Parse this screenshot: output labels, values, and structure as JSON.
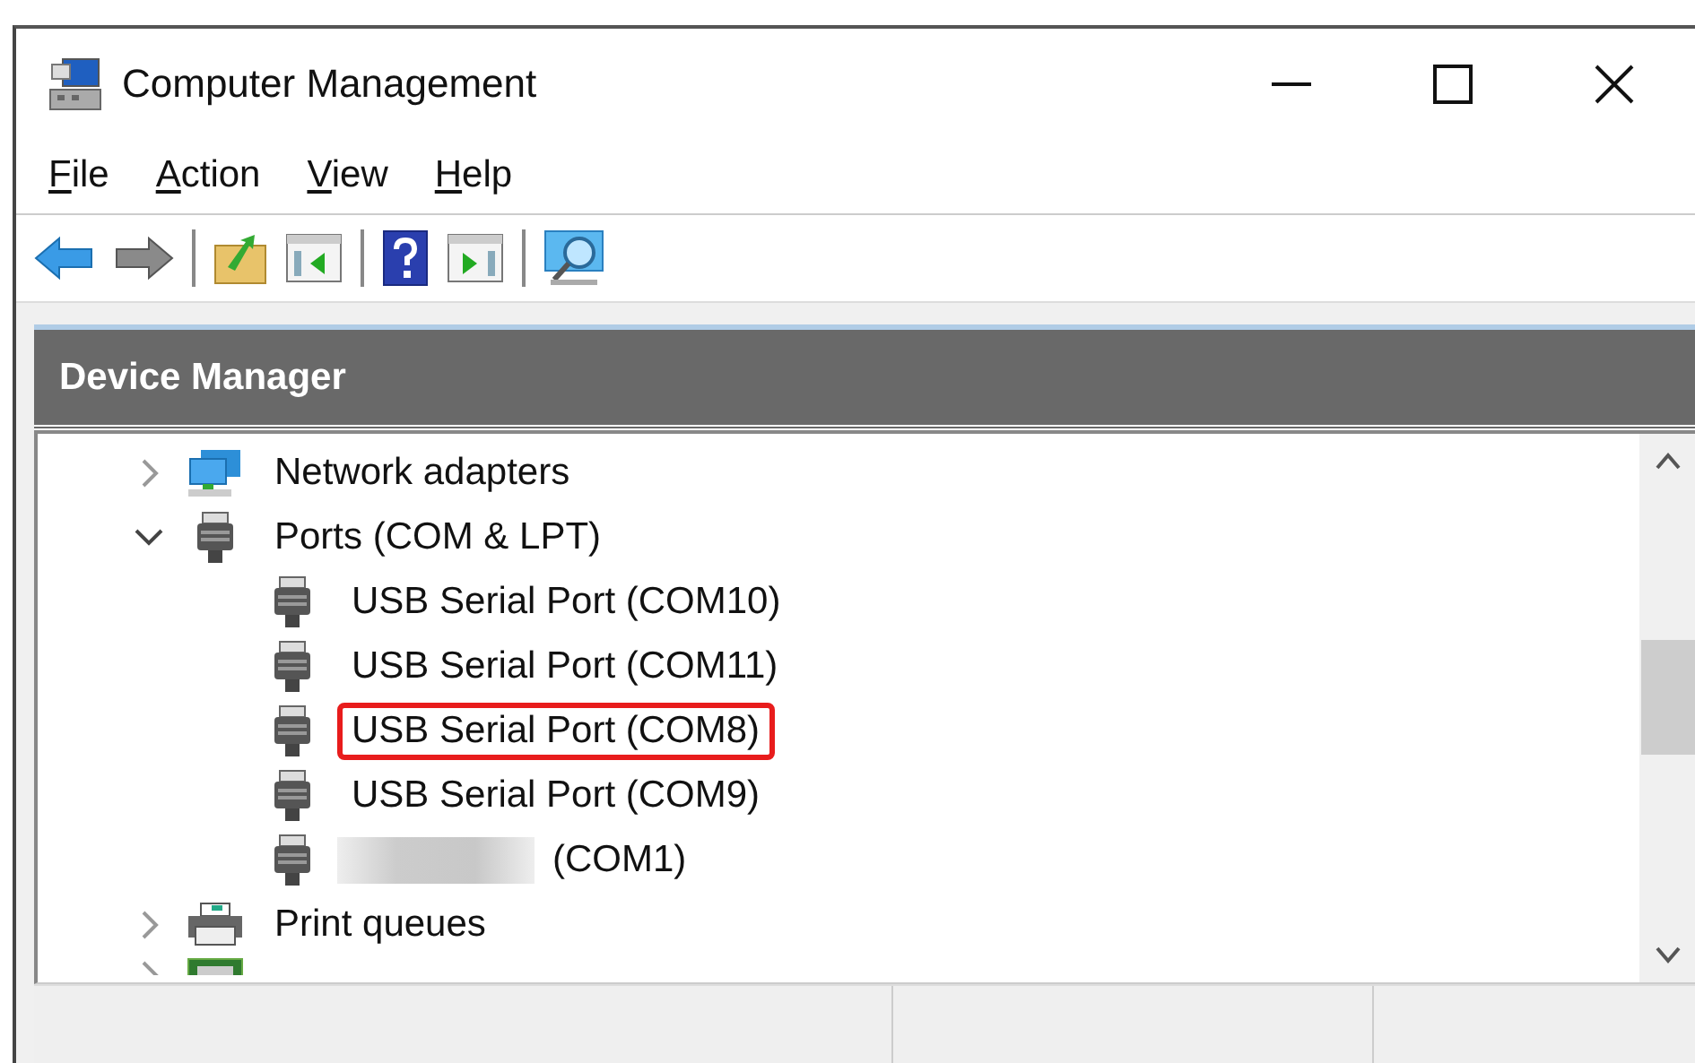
{
  "window": {
    "title": "Computer Management"
  },
  "menu": [
    {
      "label": "File"
    },
    {
      "label": "Action"
    },
    {
      "label": "View"
    },
    {
      "label": "Help"
    }
  ],
  "toolbar": [
    {
      "kind": "back"
    },
    {
      "kind": "forward"
    },
    {
      "kind": "separator"
    },
    {
      "kind": "up"
    },
    {
      "kind": "hide-pane"
    },
    {
      "kind": "separator"
    },
    {
      "kind": "help"
    },
    {
      "kind": "show-pane"
    },
    {
      "kind": "separator"
    },
    {
      "kind": "scan"
    }
  ],
  "pane": {
    "title": "Device Manager"
  },
  "tree": [
    {
      "label": "Network adapters",
      "kind": "network",
      "expanded": false
    },
    {
      "label": "Ports (COM & LPT)",
      "kind": "port",
      "expanded": true,
      "children": [
        {
          "label": "USB Serial Port (COM10)",
          "kind": "port",
          "highlighted": false
        },
        {
          "label": "USB Serial Port (COM11)",
          "kind": "port",
          "highlighted": false
        },
        {
          "label": "USB Serial Port (COM8)",
          "kind": "port",
          "highlighted": true
        },
        {
          "label": "USB Serial Port (COM9)",
          "kind": "port",
          "highlighted": false
        },
        {
          "label": "(COM1)",
          "kind": "port",
          "redacted": true,
          "highlighted": false
        }
      ]
    },
    {
      "label": "Print queues",
      "kind": "printer",
      "expanded": false
    },
    {
      "kind": "chip",
      "expanded": false
    }
  ]
}
